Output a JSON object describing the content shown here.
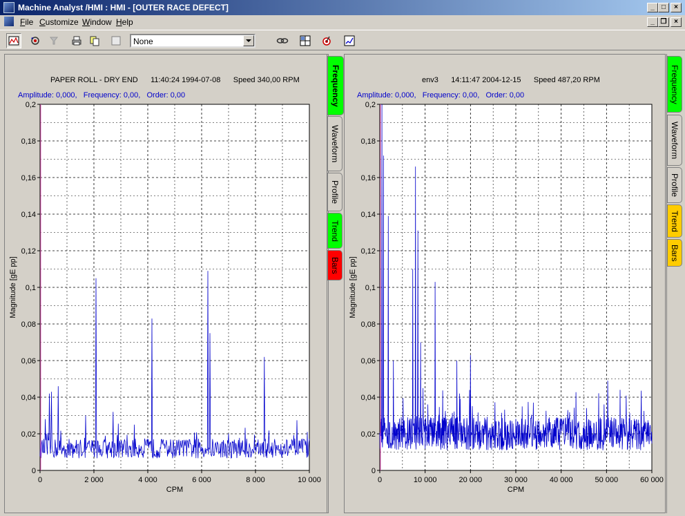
{
  "window": {
    "title": "Machine Analyst /HMI : HMI - [OUTER RACE DEFECT]"
  },
  "menu": {
    "items": [
      {
        "label": "File",
        "accel": "F",
        "rest": "ile"
      },
      {
        "label": "Customize",
        "accel": "C",
        "rest": "ustomize"
      },
      {
        "label": "Window",
        "accel": "W",
        "rest": "indow"
      },
      {
        "label": "Help",
        "accel": "H",
        "rest": "elp"
      }
    ]
  },
  "toolbar": {
    "combo_value": "None",
    "icons": [
      "spectrum-view-icon",
      "rotate-icon",
      "filter-icon",
      "printer-icon",
      "copy-icon",
      "blank-icon",
      "link-icon",
      "grid-layout-icon",
      "target-icon",
      "chart-icon"
    ]
  },
  "colors": {
    "frequency_tab": "#00ff00",
    "trend_tab_left": "#00ff00",
    "bars_tab_left": "#ff0000",
    "trend_tab_right": "#ffcc00",
    "bars_tab_right": "#ffcc00",
    "series": "#0000cc"
  },
  "tabs": {
    "left": [
      "Frequency",
      "Waveform",
      "Profile",
      "Trend",
      "Bars"
    ],
    "right": [
      "Frequency",
      "Waveform",
      "Profile",
      "Trend",
      "Bars"
    ]
  },
  "chart_data": [
    {
      "type": "line",
      "title": "PAPER ROLL - DRY END      11:40:24 1994-07-08      Speed 340,00 RPM",
      "readout": "Amplitude: 0,000,   Frequency: 0,00,   Order: 0,00",
      "xlabel": "CPM",
      "ylabel": "Magnitude [gE pp]",
      "xlim": [
        0,
        10000
      ],
      "ylim": [
        0,
        0.2
      ],
      "xticks": [
        0,
        2000,
        4000,
        6000,
        8000,
        10000
      ],
      "xtick_labels": [
        "0",
        "2 000",
        "4 000",
        "6 000",
        "8 000",
        "10 000"
      ],
      "yticks": [
        0,
        0.02,
        0.04,
        0.06,
        0.08,
        0.1,
        0.12,
        0.14,
        0.16,
        0.18,
        0.2
      ],
      "ytick_labels": [
        "0",
        "0,02",
        "0,04",
        "0,06",
        "0,08",
        "0,1",
        "0,12",
        "0,14",
        "0,16",
        "0,18",
        "0,2"
      ],
      "grid": true,
      "noise_level": 0.012,
      "peaks": [
        {
          "x": 200,
          "y": 0.028
        },
        {
          "x": 340,
          "y": 0.042
        },
        {
          "x": 420,
          "y": 0.043
        },
        {
          "x": 680,
          "y": 0.046
        },
        {
          "x": 1700,
          "y": 0.03
        },
        {
          "x": 2080,
          "y": 0.105
        },
        {
          "x": 2720,
          "y": 0.032
        },
        {
          "x": 3500,
          "y": 0.025
        },
        {
          "x": 4160,
          "y": 0.083
        },
        {
          "x": 6240,
          "y": 0.109
        },
        {
          "x": 6300,
          "y": 0.075
        },
        {
          "x": 8320,
          "y": 0.062
        }
      ]
    },
    {
      "type": "line",
      "title": "env3      14:11:47 2004-12-15      Speed 487,20 RPM",
      "readout": "Amplitude: 0,000,   Frequency: 0,00,   Order: 0,00",
      "xlabel": "CPM",
      "ylabel": "Magnitude [gE pp]",
      "xlim": [
        0,
        60000
      ],
      "ylim": [
        0,
        0.2
      ],
      "xticks": [
        0,
        10000,
        20000,
        30000,
        40000,
        50000,
        60000
      ],
      "xtick_labels": [
        "0",
        "10 000",
        "20 000",
        "30 000",
        "40 000",
        "50 000",
        "60 000"
      ],
      "yticks": [
        0,
        0.02,
        0.04,
        0.06,
        0.08,
        0.1,
        0.12,
        0.14,
        0.16,
        0.18,
        0.2
      ],
      "ytick_labels": [
        "0",
        "0,02",
        "0,04",
        "0,06",
        "0,08",
        "0,1",
        "0,12",
        "0,14",
        "0,16",
        "0,18",
        "0,2"
      ],
      "grid": true,
      "noise_level": 0.02,
      "peaks": [
        {
          "x": 500,
          "y": 0.2
        },
        {
          "x": 800,
          "y": 0.172
        },
        {
          "x": 1900,
          "y": 0.139
        },
        {
          "x": 3000,
          "y": 0.06
        },
        {
          "x": 7300,
          "y": 0.11
        },
        {
          "x": 7900,
          "y": 0.166
        },
        {
          "x": 8400,
          "y": 0.131
        },
        {
          "x": 9000,
          "y": 0.07
        },
        {
          "x": 12200,
          "y": 0.103
        },
        {
          "x": 17000,
          "y": 0.06
        },
        {
          "x": 20000,
          "y": 0.063
        },
        {
          "x": 50300,
          "y": 0.049
        },
        {
          "x": 53000,
          "y": 0.044
        }
      ]
    }
  ]
}
